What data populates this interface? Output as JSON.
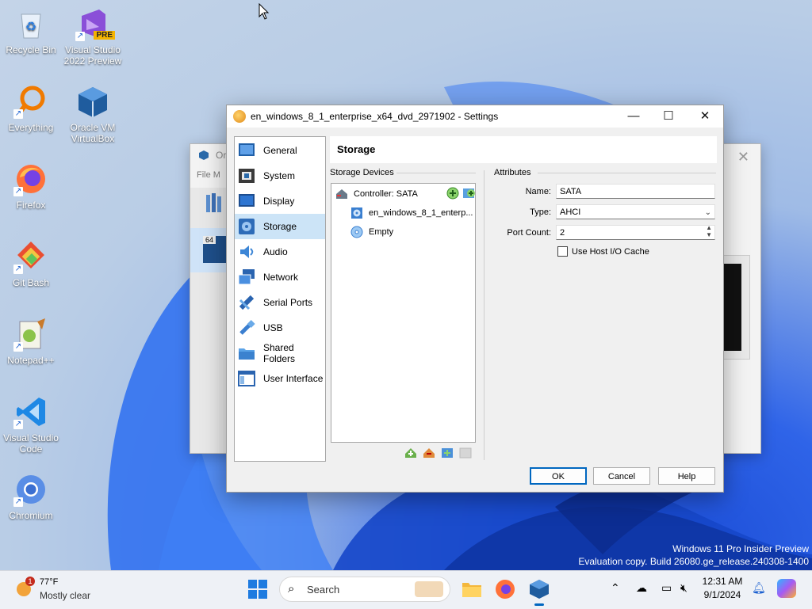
{
  "desktop": {
    "icons": [
      {
        "label": "Recycle Bin"
      },
      {
        "label": "Visual Studio 2022 Preview",
        "badge": "PRE"
      },
      {
        "label": "Everything"
      },
      {
        "label": "Oracle VM VirtualBox"
      },
      {
        "label": "Firefox"
      },
      {
        "label": "Git Bash"
      },
      {
        "label": "Notepad++"
      },
      {
        "label": "Visual Studio Code"
      },
      {
        "label": "Chromium"
      }
    ],
    "watermark": {
      "line1": "Windows 11 Pro Insider Preview",
      "line2": "Evaluation copy. Build 26080.ge_release.240308-1400"
    }
  },
  "manager": {
    "title": "Or",
    "menu": "File   M",
    "thumb_badge": "64"
  },
  "dialog": {
    "title": "en_windows_8_1_enterprise_x64_dvd_2971902 - Settings",
    "controls": {
      "minimize": "—",
      "maximize": "☐",
      "close": "✕"
    },
    "sidebar": [
      {
        "label": "General",
        "icon": "general-icon"
      },
      {
        "label": "System",
        "icon": "system-icon"
      },
      {
        "label": "Display",
        "icon": "display-icon"
      },
      {
        "label": "Storage",
        "icon": "storage-icon",
        "selected": true
      },
      {
        "label": "Audio",
        "icon": "audio-icon"
      },
      {
        "label": "Network",
        "icon": "network-icon"
      },
      {
        "label": "Serial Ports",
        "icon": "serial-ports-icon"
      },
      {
        "label": "USB",
        "icon": "usb-icon"
      },
      {
        "label": "Shared Folders",
        "icon": "shared-folders-icon"
      },
      {
        "label": "User Interface",
        "icon": "user-interface-icon"
      }
    ],
    "pane_title": "Storage",
    "storage_devices_label": "Storage Devices",
    "tree": {
      "controller": "Controller: SATA",
      "items": [
        "en_windows_8_1_enterp...",
        "Empty"
      ]
    },
    "attributes": {
      "label": "Attributes",
      "name_label": "Name:",
      "name_value": "SATA",
      "type_label": "Type:",
      "type_value": "AHCI",
      "port_count_label": "Port Count:",
      "port_count_value": "2",
      "host_io_cache_label": "Use Host I/O Cache",
      "host_io_cache_checked": false
    },
    "buttons": {
      "ok": "OK",
      "cancel": "Cancel",
      "help": "Help"
    }
  },
  "taskbar": {
    "weather": {
      "temp": "77°F",
      "condition": "Mostly clear",
      "badge": "1"
    },
    "search_placeholder": "Search",
    "clock": {
      "time": "12:31 AM",
      "date": "9/1/2024"
    },
    "colors": {
      "accent": "#0067c0",
      "selection": "#cce4f7"
    }
  }
}
